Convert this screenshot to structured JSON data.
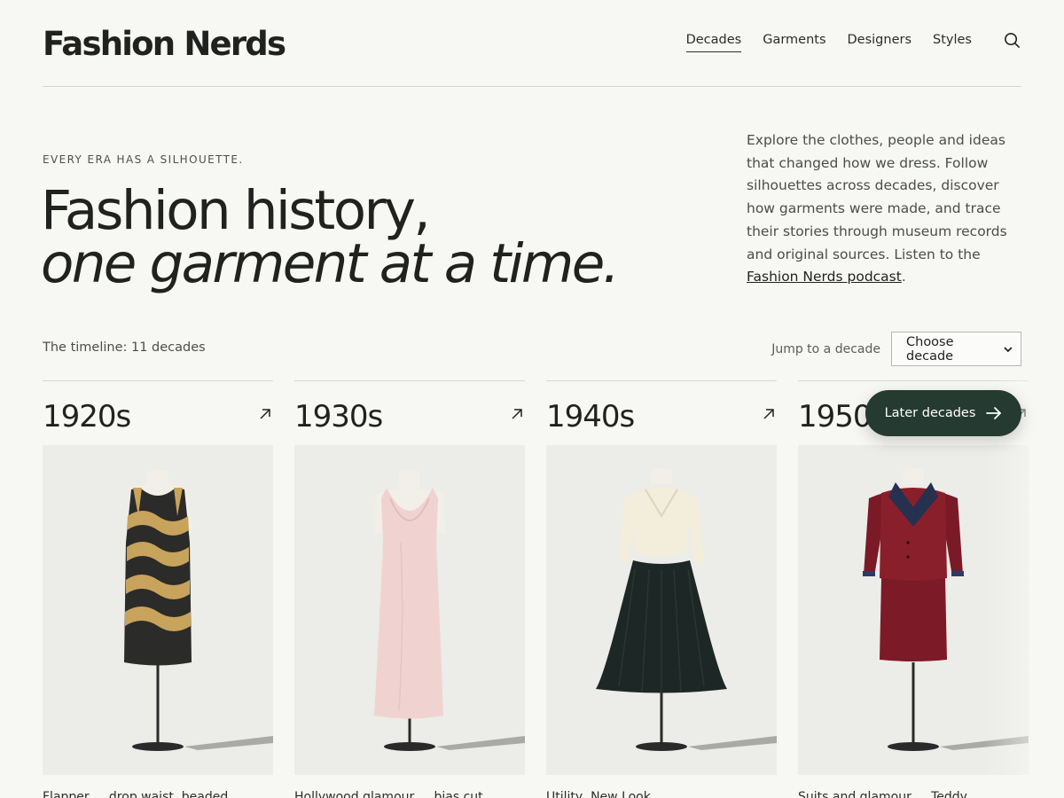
{
  "site": {
    "logo": "Fashion Nerds"
  },
  "nav": {
    "items": [
      {
        "label": "Decades",
        "active": true
      },
      {
        "label": "Garments",
        "active": false
      },
      {
        "label": "Designers",
        "active": false
      },
      {
        "label": "Styles",
        "active": false
      }
    ],
    "search_icon": "search-icon"
  },
  "hero": {
    "eyebrow": "EVERY ERA HAS A SILHOUETTE.",
    "title_line1": "Fashion history,",
    "title_line2": "one garment at a time.",
    "description": "Explore the clothes, people and ideas that changed how we dress. Follow silhouettes across decades, discover how garments were made, and trace their stories through museum records and original sources. Listen to the ",
    "podcast_link": "Fashion Nerds podcast",
    "description_end": "."
  },
  "timeline": {
    "count_label": "The timeline: 11 decades",
    "jump_label": "Jump to a decade",
    "select_value": "Choose decade",
    "later_button": "Later decades",
    "cards": [
      {
        "decade": "1920s",
        "caption": "Flapper ... drop waist, beaded ..."
      },
      {
        "decade": "1930s",
        "caption": "Hollywood glamour ... bias cut"
      },
      {
        "decade": "1940s",
        "caption": "Utility, New Look ..."
      },
      {
        "decade": "1950s",
        "caption": "Suits and glamour ... Teddy ..."
      }
    ]
  },
  "colors": {
    "background": "#f7f7f4",
    "text": "#1f221f",
    "button_dark_green": "#253a31",
    "card_image_bg": "#ecece8"
  }
}
